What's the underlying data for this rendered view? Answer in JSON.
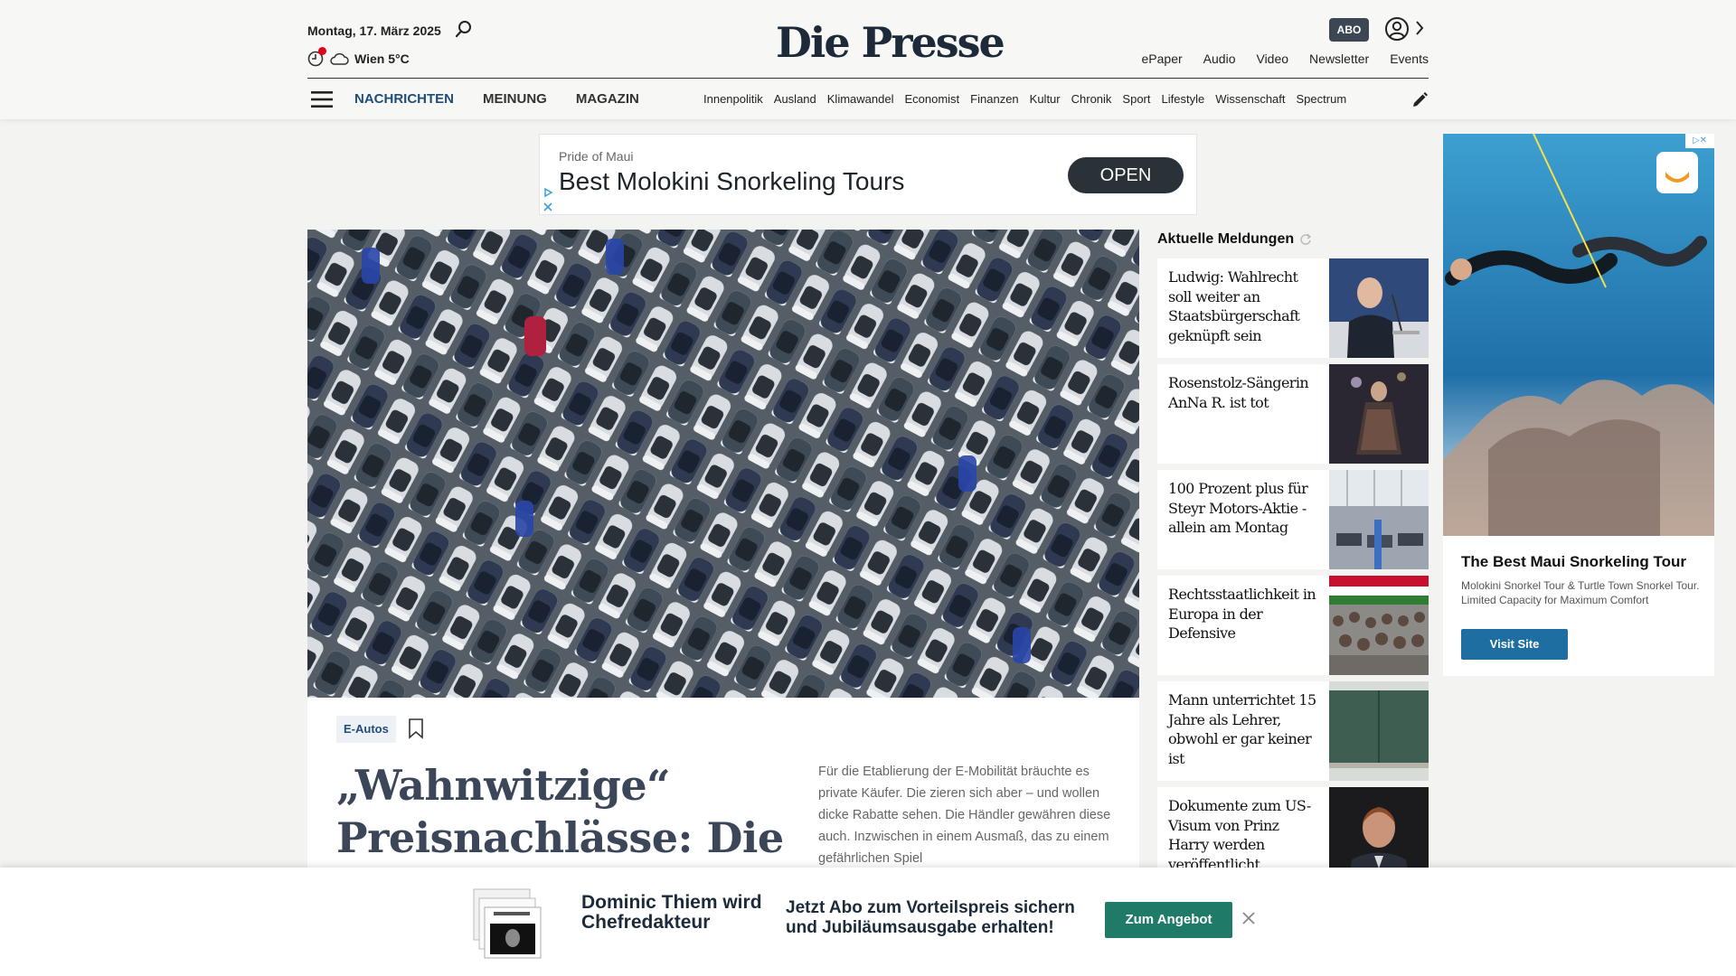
{
  "header": {
    "date": "Montag, 17. März 2025",
    "weather": "Wien 5°C",
    "logo": "Die Presse",
    "abo": "ABO",
    "services": [
      "ePaper",
      "Audio",
      "Video",
      "Newsletter",
      "Events"
    ]
  },
  "nav": {
    "primary": [
      "NACHRICHTEN",
      "MEINUNG",
      "MAGAZIN"
    ],
    "secondary": [
      "Innenpolitik",
      "Ausland",
      "Klimawandel",
      "Economist",
      "Finanzen",
      "Kultur",
      "Chronik",
      "Sport",
      "Lifestyle",
      "Wissenschaft",
      "Spectrum"
    ]
  },
  "top_ad": {
    "advertiser": "Pride of Maui",
    "headline": "Best Molokini Snorkeling Tours",
    "button": "OPEN"
  },
  "hero": {
    "tag": "E-Autos",
    "title": "„Wahnwitzige“ Preisnachlässe: Die",
    "teaser": "Für die Etablierung der E-Mobilität bräuchte es private Käufer. Die zieren sich aber – und wollen dicke Rabatte sehen. Die Händler gewähren diese auch. Inzwischen in einem Ausmaß, das zu einem gefährlichen Spiel"
  },
  "news": {
    "heading": "Aktuelle Meldungen",
    "items": [
      {
        "title": "Ludwig: Wahlrecht soll weiter an Staatsbürgerschaft geknüpft sein"
      },
      {
        "title": "Rosenstolz-Sängerin AnNa R. ist tot"
      },
      {
        "title": "100 Prozent plus für Steyr Motors-Aktie - allein am Montag"
      },
      {
        "title": "Rechtsstaatlichkeit in Europa in der Defensive"
      },
      {
        "title": "Mann unterrichtet 15 Jahre als Lehrer, obwohl er gar keiner ist"
      },
      {
        "title": "Dokumente zum US-Visum von Prinz Harry werden veröffentlicht"
      }
    ]
  },
  "side_ad": {
    "title": "The Best Maui Snorkeling Tour",
    "description": "Molokini Snorkel Tour & Turtle Town Snorkel Tour. Limited Capacity for Maximum Comfort",
    "button": "Visit Site"
  },
  "promo": {
    "headline": "Dominic Thiem wird Chefredakteur",
    "offer": "Jetzt Abo zum Vorteilspreis sichern und Jubiläumsausgabe erhalten!",
    "button": "Zum Angebot"
  },
  "colors": {
    "nav_active": "#1f4e79",
    "abo_badge": "#3d4754",
    "cta_green": "#1f7a68",
    "weather_alert": "#e2001a"
  }
}
